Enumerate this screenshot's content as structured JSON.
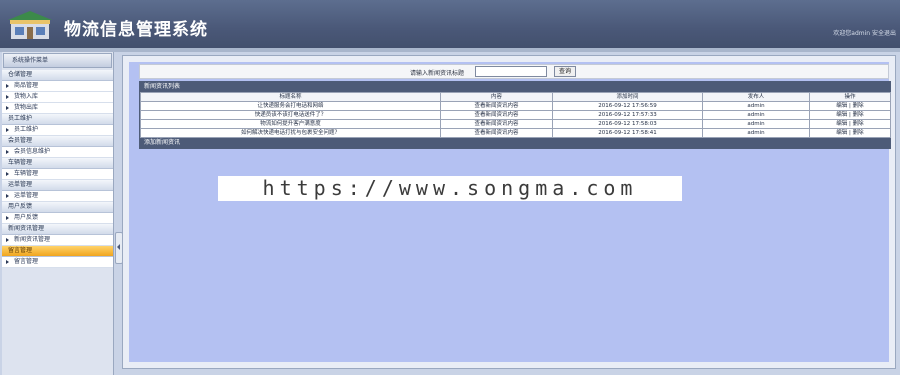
{
  "header": {
    "app_title": "物流信息管理系统",
    "welcome_text": "欢迎您admin  安全退出"
  },
  "sidebar": {
    "title": "系统操作菜单",
    "groups": [
      {
        "label": "仓储管理",
        "items": [
          {
            "label": "商品管理"
          },
          {
            "label": "货物入库"
          },
          {
            "label": "货物出库"
          }
        ]
      },
      {
        "label": "员工维护",
        "items": [
          {
            "label": "员工维护"
          }
        ]
      },
      {
        "label": "会员管理",
        "items": [
          {
            "label": "会员信息维护"
          }
        ]
      },
      {
        "label": "车辆管理",
        "items": [
          {
            "label": "车辆管理"
          }
        ]
      },
      {
        "label": "运单管理",
        "items": [
          {
            "label": "运单管理"
          }
        ]
      },
      {
        "label": "用户反馈",
        "items": [
          {
            "label": "用户反馈"
          }
        ]
      },
      {
        "label": "新闻资讯管理",
        "items": [
          {
            "label": "新闻资讯管理"
          }
        ]
      },
      {
        "label": "留言管理",
        "items": [
          {
            "label": "留言管理"
          }
        ],
        "active": true
      }
    ]
  },
  "search": {
    "label": "请输入新闻资讯标题",
    "input_value": "",
    "button_label": "查询"
  },
  "table": {
    "title": "新闻资讯列表",
    "columns": [
      "标题名称",
      "内容",
      "添加时间",
      "发布人",
      "操作"
    ],
    "rows": [
      {
        "title": "让快递服务会打电话和网络",
        "content": "查看新闻资讯内容",
        "time": "2016-09-12 17:56:59",
        "author": "admin",
        "edit": "编辑",
        "del": "删除"
      },
      {
        "title": "快递员该不该打电话送件了？",
        "content": "查看新闻资讯内容",
        "time": "2016-09-12 17:57:33",
        "author": "admin",
        "edit": "编辑",
        "del": "删除"
      },
      {
        "title": "物流如何提升客户满意度",
        "content": "查看新闻资讯内容",
        "time": "2016-09-12 17:58:03",
        "author": "admin",
        "edit": "编辑",
        "del": "删除"
      },
      {
        "title": "如何解决快递电话打扰与包裹安全问题？",
        "content": "查看新闻资讯内容",
        "time": "2016-09-12 17:58:41",
        "author": "admin",
        "edit": "编辑",
        "del": "删除"
      }
    ],
    "footer": "添加新闻资讯"
  },
  "watermark": "https://www.songma.com",
  "colors": {
    "header_bg": "#4a5878",
    "content_bg": "#b4c1f2",
    "active_menu": "#f0a51e"
  }
}
